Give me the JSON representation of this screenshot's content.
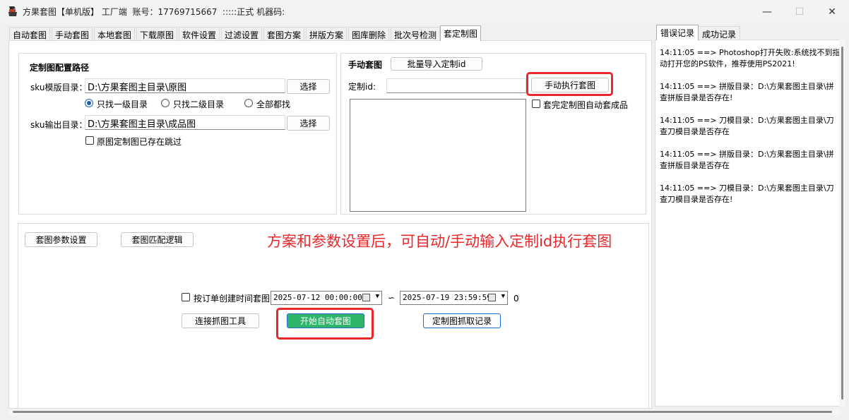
{
  "window": {
    "title": "方果套图【单机版】 工厂端  账号：17769715667  :::::正式 机器码:",
    "minimize": "—",
    "maximize": "☐",
    "close": "✕"
  },
  "tabs": [
    "自动套图",
    "手动套图",
    "本地套图",
    "下载原图",
    "软件设置",
    "过滤设置",
    "套图方案",
    "拼版方案",
    "图库删除",
    "批次号检测",
    "套定制图"
  ],
  "active_tab": "套定制图",
  "config": {
    "heading": "定制图配置路径",
    "sku_template_label": "sku模版目录：",
    "sku_template_value": "D:\\方果套图主目录\\原图",
    "select_label": "选择",
    "radio_options": [
      "只找一级目录",
      "只找二级目录",
      "全部都找"
    ],
    "sku_output_label": "sku输出目录：",
    "sku_output_value": "D:\\方果套图主目录\\成品图",
    "skip_existing_label": "原图定制图已存在跳过"
  },
  "manual": {
    "heading": "手动套图",
    "batch_import_label": "批量导入定制id",
    "custom_id_label": "定制id:",
    "custom_id_value": "",
    "execute_label": "手动执行套图",
    "auto_finish_label": "套完定制图自动套成品"
  },
  "bottom": {
    "param_settings_label": "套图参数设置",
    "match_logic_label": "套图匹配逻辑",
    "annotation": "方案和参数设置后，可自动/手动输入定制id执行套图",
    "annotation_color": "#e8282b",
    "order_time_label": "按订单创建时间套图",
    "date_start": "2025-07-12 00:00:00",
    "range_sep": "∽",
    "date_end": "2025-07-19 23:59:59",
    "count": "0",
    "connect_tool_label": "连接抓图工具",
    "start_auto_label": "开始自动套图",
    "capture_records_label": "定制图抓取记录"
  },
  "log_tabs": [
    "错误记录",
    "成功记录"
  ],
  "log_entries": [
    [
      "14:11:05 ==> Photoshop打开失败:系统找不到指",
      "动打开您的PS软件，推荐使用PS2021!"
    ],
    [
      "14:11:05 ==> 拼版目录：D:\\方果套图主目录\\拼",
      "查拼版目录是否存在!"
    ],
    [
      "14:11:05 ==> 刀模目录：D:\\方果套图主目录\\刀",
      "查刀模目录是否存在"
    ],
    [
      "14:11:05 ==> 拼版目录：D:\\方果套图主目录\\拼",
      "查拼版目录是否存在"
    ],
    [
      "14:11:05 ==> 刀模目录：D:\\方果套图主目录\\刀",
      "查刀模目录是否存在!"
    ]
  ],
  "colors": {
    "highlight_red": "#e8282b",
    "start_button_green": "#2fb56a",
    "accent_blue": "#1a5fb4"
  }
}
